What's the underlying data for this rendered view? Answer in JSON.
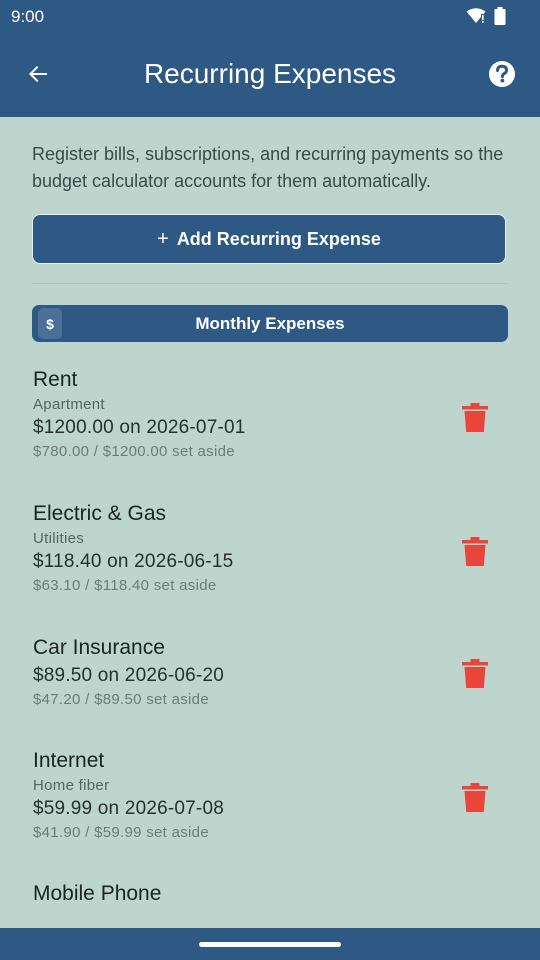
{
  "status_bar": {
    "time": "9:00"
  },
  "app_bar": {
    "title": "Recurring Expenses"
  },
  "intro_text": "Register bills, subscriptions, and recurring payments so the budget calculator accounts for them automatically.",
  "add_button": {
    "label": "Add Recurring Expense"
  },
  "section": {
    "badge": "$",
    "title": "Monthly Expenses"
  },
  "expenses": [
    {
      "name": "Rent",
      "category": "Apartment",
      "amount": "$1200.00 on 2026-07-01",
      "set_aside": "$780.00 / $1200.00 set aside"
    },
    {
      "name": "Electric & Gas",
      "category": "Utilities",
      "amount": "$118.40 on 2026-06-15",
      "set_aside": "$63.10 / $118.40 set aside"
    },
    {
      "name": "Car Insurance",
      "amount": "$89.50 on 2026-06-20",
      "set_aside": "$47.20 / $89.50 set aside"
    },
    {
      "name": "Internet",
      "category": "Home fiber",
      "amount": "$59.99 on 2026-07-08",
      "set_aside": "$41.90 / $59.99 set aside"
    },
    {
      "name": "Mobile Phone"
    }
  ],
  "colors": {
    "primary": "#2e5985",
    "background": "#bdd5cd",
    "delete": "#e8463b"
  }
}
